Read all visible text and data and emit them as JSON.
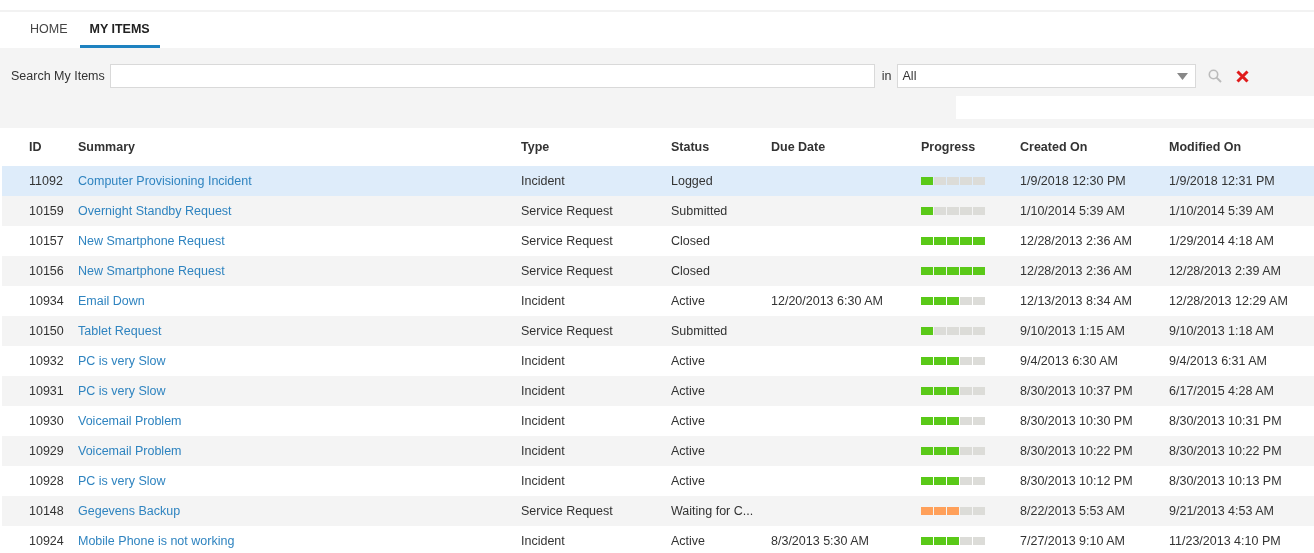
{
  "tabs": [
    {
      "label": "HOME",
      "selected": false
    },
    {
      "label": "MY ITEMS",
      "selected": true
    }
  ],
  "search": {
    "label": "Search My Items",
    "in_label": "in",
    "scope": "All"
  },
  "table": {
    "columns": [
      "ID",
      "Summary",
      "Type",
      "Status",
      "Due Date",
      "Progress",
      "Created On",
      "Modified On"
    ],
    "rows": [
      {
        "id": "11092",
        "summary": "Computer Provisioning Incident",
        "type": "Incident",
        "status": "Logged",
        "progress": {
          "level": 0.2,
          "color": "#5ac918"
        },
        "created": "1/9/2018 12:30 PM",
        "modified": "1/9/2018 12:31 PM",
        "selected": true
      },
      {
        "id": "10159",
        "summary": "Overnight Standby Request",
        "type": "Service Request",
        "status": "Submitted",
        "progress": {
          "level": 0.2,
          "color": "#5ac918"
        },
        "created": "1/10/2014 5:39 AM",
        "modified": "1/10/2014 5:39 AM",
        "selected": false
      },
      {
        "id": "10157",
        "summary": "New Smartphone Request",
        "type": "Service Request",
        "status": "Closed",
        "progress": {
          "level": 1,
          "color": "#5ac918"
        },
        "created": "12/28/2013 2:36 AM",
        "modified": "1/29/2014 4:18 AM",
        "selected": false
      },
      {
        "id": "10156",
        "summary": "New Smartphone Request",
        "type": "Service Request",
        "status": "Closed",
        "progress": {
          "level": 1,
          "color": "#5ac918"
        },
        "created": "12/28/2013 2:36 AM",
        "modified": "12/28/2013 2:39 AM",
        "selected": false
      },
      {
        "id": "10934",
        "summary": "Email Down",
        "type": "Incident",
        "status": "Active",
        "due": "12/20/2013 6:30 AM",
        "progress": {
          "level": 0.6,
          "color": "#5ac918"
        },
        "created": "12/13/2013 8:34 AM",
        "modified": "12/28/2013 12:29 AM",
        "selected": false
      },
      {
        "id": "10150",
        "summary": "Tablet Request",
        "type": "Service Request",
        "status": "Submitted",
        "progress": {
          "level": 0.2,
          "color": "#5ac918"
        },
        "created": "9/10/2013 1:15 AM",
        "modified": "9/10/2013 1:18 AM",
        "selected": false
      },
      {
        "id": "10932",
        "summary": "PC is very Slow",
        "type": "Incident",
        "status": "Active",
        "progress": {
          "level": 0.6,
          "color": "#5ac918"
        },
        "created": "9/4/2013 6:30 AM",
        "modified": "9/4/2013 6:31 AM",
        "selected": false
      },
      {
        "id": "10931",
        "summary": "PC is very Slow",
        "type": "Incident",
        "status": "Active",
        "progress": {
          "level": 0.6,
          "color": "#5ac918"
        },
        "created": "8/30/2013 10:37 PM",
        "modified": "6/17/2015 4:28 AM",
        "selected": false
      },
      {
        "id": "10930",
        "summary": "Voicemail Problem",
        "type": "Incident",
        "status": "Active",
        "progress": {
          "level": 0.6,
          "color": "#5ac918"
        },
        "created": "8/30/2013 10:30 PM",
        "modified": "8/30/2013 10:31 PM",
        "selected": false
      },
      {
        "id": "10929",
        "summary": "Voicemail Problem",
        "type": "Incident",
        "status": "Active",
        "progress": {
          "level": 0.6,
          "color": "#5ac918"
        },
        "created": "8/30/2013 10:22 PM",
        "modified": "8/30/2013 10:22 PM",
        "selected": false
      },
      {
        "id": "10928",
        "summary": "PC is very Slow",
        "type": "Incident",
        "status": "Active",
        "progress": {
          "level": 0.6,
          "color": "#5ac918"
        },
        "created": "8/30/2013 10:12 PM",
        "modified": "8/30/2013 10:13 PM",
        "selected": false
      },
      {
        "id": "10148",
        "summary": "Gegevens Backup",
        "type": "Service Request",
        "status": "Waiting for C...",
        "progress": {
          "level": 0.6,
          "color": "#ffa05a"
        },
        "created": "8/22/2013 5:53 AM",
        "modified": "9/21/2013 4:53 AM",
        "selected": false
      },
      {
        "id": "10924",
        "summary": "Mobile Phone is not working",
        "type": "Incident",
        "status": "Active",
        "due": "8/3/2013 5:30 AM",
        "progress": {
          "level": 0.6,
          "color": "#5ac918"
        },
        "created": "7/27/2013 9:10 AM",
        "modified": "11/23/2013 4:10 PM",
        "selected": false
      }
    ]
  }
}
